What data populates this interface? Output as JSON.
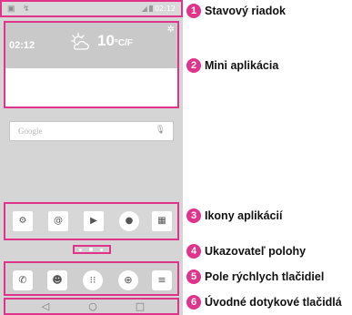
{
  "status_bar": {
    "left_icons": "▣ ↯",
    "signal": "◢",
    "time": "02:12"
  },
  "widget": {
    "time": "02:12",
    "temperature": "10",
    "unit": "°C/F"
  },
  "search": {
    "label": "Google"
  },
  "callouts": [
    {
      "number": "1",
      "label": "Stavový riadok"
    },
    {
      "number": "2",
      "label": "Mini aplikácia"
    },
    {
      "number": "3",
      "label": "Ikony aplikácií"
    },
    {
      "number": "4",
      "label": "Ukazovateľ polohy"
    },
    {
      "number": "5",
      "label": "Pole rýchlych tlačidiel"
    },
    {
      "number": "6",
      "label": "Úvodné dotykové tlačidlá"
    }
  ],
  "apps_icons": [
    "settings-icon",
    "email-icon",
    "play-store-icon",
    "camera-icon",
    "apps-folder-icon"
  ],
  "dock_icons": [
    "phone-icon",
    "contacts-icon",
    "apps-icon",
    "browser-icon",
    "messages-icon"
  ],
  "nav_icons": [
    "back-icon",
    "home-icon",
    "recent-apps-icon"
  ],
  "colors": {
    "accent": "#e0338c",
    "screen": "#d5d5d5"
  }
}
